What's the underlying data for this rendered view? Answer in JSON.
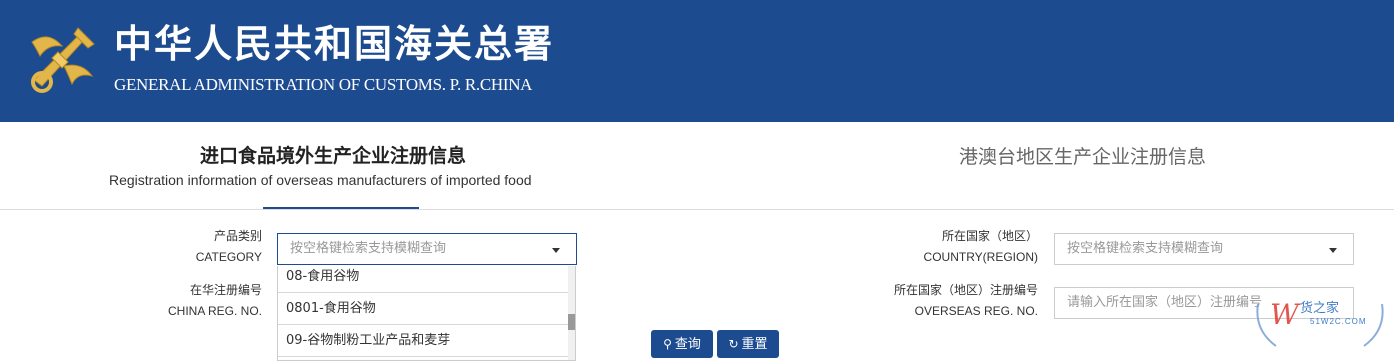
{
  "header": {
    "title_cn": "中华人民共和国海关总署",
    "title_en": "GENERAL ADMINISTRATION OF CUSTOMS. P. R.CHINA",
    "emblem_icon": "customs-emblem-icon",
    "bg_color": "#1d4b8f"
  },
  "tabs": [
    {
      "label_cn": "进口食品境外生产企业注册信息",
      "label_en": "Registration information of overseas manufacturers of imported food",
      "active": true
    },
    {
      "label_cn": "港澳台地区生产企业注册信息",
      "active": false
    }
  ],
  "form": {
    "category": {
      "label_cn": "产品类别",
      "label_en": "CATEGORY",
      "placeholder": "按空格键检索支持模糊查询"
    },
    "country": {
      "label_cn": "所在国家（地区）",
      "label_en": "COUNTRY(REGION)",
      "placeholder": "按空格键检索支持模糊查询"
    },
    "china_reg": {
      "label_cn": "在华注册编号",
      "label_en": "CHINA REG. NO."
    },
    "overseas_reg": {
      "label_cn": "所在国家（地区）注册编号",
      "label_en": "OVERSEAS REG. NO.",
      "placeholder": "请输入所在国家（地区）注册编号"
    },
    "dropdown_options": [
      "08-食用谷物",
      "0801-食用谷物",
      "09-谷物制粉工业产品和麦芽"
    ]
  },
  "buttons": {
    "search_label": "查询",
    "reset_label": "重置"
  },
  "watermark": {
    "text": "货之家",
    "sub": "51W2C.COM"
  }
}
